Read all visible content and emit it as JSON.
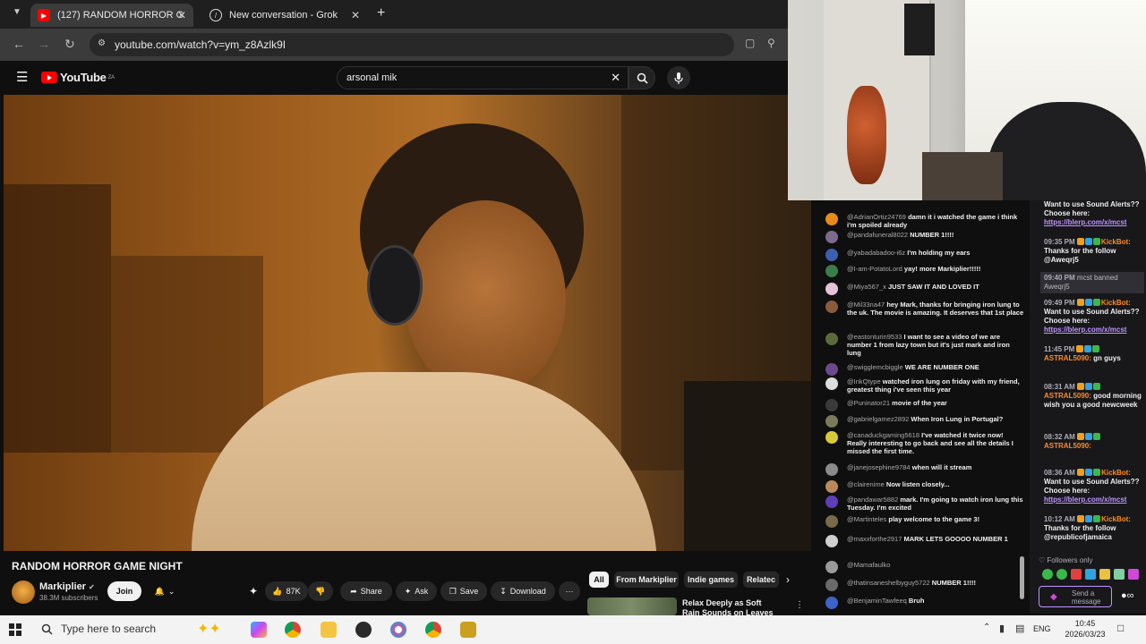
{
  "browser": {
    "tabs": [
      {
        "label": "(127) RANDOM HORROR G",
        "active": true
      },
      {
        "label": "New conversation - Grok",
        "active": false
      }
    ],
    "url": "youtube.com/watch?v=ym_z8Azlk9I"
  },
  "youtube": {
    "logo": "YouTube",
    "country": "ZA",
    "search_value": "arsonal mik",
    "video_title": "RANDOM HORROR GAME NIGHT",
    "channel": "Markiplier",
    "subscribers": "38.3M subscribers",
    "join_label": "Join",
    "likes": "87K",
    "share_label": "Share",
    "ask_label": "Ask",
    "save_label": "Save",
    "download_label": "Download",
    "chips": [
      "All",
      "From Markiplier",
      "Indie games",
      "Relatec"
    ],
    "related_title": "Relax Deeply as Soft Rain Sounds on Leaves Washes"
  },
  "live_chat": [
    {
      "user": "@AdrianOrtiz24769",
      "msg": "damn it i watched the game i think i'm spoiled already",
      "color": "#e8891a"
    },
    {
      "user": "@pandafuneral8022",
      "msg": "NUMBER 1!!!!",
      "color": "#7d6a8c"
    },
    {
      "user": "@yabadabadoo-i6z",
      "msg": "I'm holding my ears",
      "color": "#3d5fb0"
    },
    {
      "user": "@I-am-PotatoLord",
      "msg": "yay! more Markiplier!!!!!",
      "color": "#3b7d4a"
    },
    {
      "user": "@Miya567_x",
      "msg": "JUST SAW IT AND LOVED IT",
      "color": "#e4c3d9"
    },
    {
      "user": "@Mil33na47",
      "msg": "hey Mark, thanks for bringing iron lung to the uk. The movie is amazing. It deserves that 1st place",
      "color": "#8a5b3c"
    },
    {
      "user": "@eastonturin9533",
      "msg": "I want to see a video of we are number 1 from lazy town but it's just mark and iron lung",
      "color": "#5a6a3a"
    },
    {
      "user": "@swigglemcbiggle",
      "msg": "WE ARE NUMBER ONE",
      "color": "#6a4a8a"
    },
    {
      "user": "@InkQtype",
      "msg": "watched iron lung on friday with my friend, greatest thing i've seen this year",
      "color": "#dddddd"
    },
    {
      "user": "@Puninator21",
      "msg": "movie of the year",
      "color": "#3a3a3a"
    },
    {
      "user": "@gabrielgamez2892",
      "msg": "When Iron Lung in Portugal?",
      "color": "#7a7a5a"
    },
    {
      "user": "@canaduckgaming5618",
      "msg": "I've watched it twice now! Really interesting to go back and see all the details I missed the first time.",
      "color": "#d6c93a"
    },
    {
      "user": "@janejosephine9784",
      "msg": "when will it stream",
      "color": "#8a8a8a"
    },
    {
      "user": "@clairenime",
      "msg": "Now listen closely...",
      "color": "#b88a5a"
    },
    {
      "user": "@pandawar5882",
      "msg": "mark. I'm going to watch iron lung this Tuesday. I'm excited",
      "color": "#5e3fb8"
    },
    {
      "user": "@Martinteles",
      "msg": "play welcome to the game 3!",
      "color": "#7a6a4a"
    },
    {
      "user": "@maxxforthe2917",
      "msg": "MARK LETS GOOOO NUMBER 1",
      "color": "#cfcfcf"
    },
    {
      "user": "@Mamafaulko",
      "msg": "",
      "color": "#9a9a9a"
    },
    {
      "user": "@thatinsaneshelbyguy5722",
      "msg": "NUMBER 1!!!!",
      "color": "#6a6a6a"
    },
    {
      "user": "@BenjaminTawfeeq",
      "msg": "Bruh",
      "color": "#3d62c8"
    }
  ],
  "twitch_chat": {
    "messages": [
      {
        "time": "",
        "user": "",
        "text": "Want to use Sound Alerts?? Choose here:",
        "link": "https://blerp.com/x/mcst"
      },
      {
        "time": "09:35 PM",
        "user": "KickBot:",
        "text": "Thanks for the follow @Aweqrj5",
        "link": ""
      },
      {
        "time": "09:40 PM",
        "user": "",
        "text": "mcst banned Aweqrj5",
        "link": ""
      },
      {
        "time": "09:49 PM",
        "user": "KickBot:",
        "text": "Want to use Sound Alerts?? Choose here:",
        "link": "https://blerp.com/x/mcst"
      },
      {
        "time": "11:45 PM",
        "user": "ASTRAL5090:",
        "text": "gn guys",
        "link": ""
      },
      {
        "time": "08:31 AM",
        "user": "ASTRAL5090:",
        "text": "good morning wish you a good newcweek",
        "link": ""
      },
      {
        "time": "08:32 AM",
        "user": "ASTRAL5090:",
        "text": "",
        "link": ""
      },
      {
        "time": "08:36 AM",
        "user": "KickBot:",
        "text": "Want to use Sound Alerts?? Choose here:",
        "link": "https://blerp.com/x/mcst"
      },
      {
        "time": "10:12 AM",
        "user": "KickBot:",
        "text": "Thanks for the follow @republicofjamaica",
        "link": ""
      }
    ],
    "followers_only": "Followers only",
    "input_placeholder": "Send a message"
  },
  "taskbar": {
    "search_placeholder": "Type here to search",
    "language": "ENG",
    "time": "10:45",
    "date": "2026/03/23"
  }
}
